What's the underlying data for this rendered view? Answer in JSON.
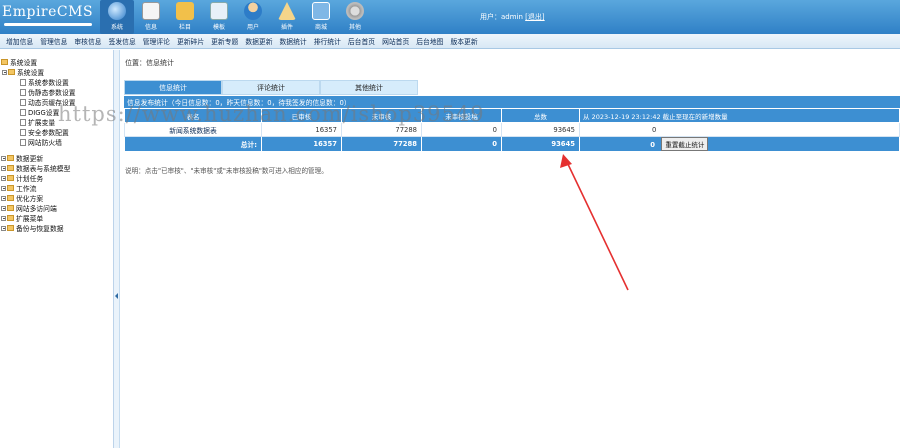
{
  "header": {
    "logo": "EmpireCMS",
    "nav": [
      "系统",
      "信息",
      "栏目",
      "模板",
      "用户",
      "插件",
      "商城",
      "其他"
    ],
    "user_label": "用户：admin",
    "logout": "[退出]"
  },
  "submenu": [
    "增加信息",
    "管理信息",
    "审核信息",
    "签发信息",
    "管理评论",
    "更新碎片",
    "更新专题",
    "数据更新",
    "数据统计",
    "排行统计",
    "后台首页",
    "网站首页",
    "后台地图",
    "版本更新"
  ],
  "sidebar": {
    "items": [
      "系统设置",
      "系统参数设置",
      "伪静态参数设置",
      "动态页缓存设置",
      "DIGG设置",
      "扩展变量",
      "安全参数配置",
      "网站防火墙",
      "数据更新",
      "数据表与系统模型",
      "计划任务",
      "工作流",
      "优化方案",
      "网站多访问端",
      "扩展菜单",
      "备份与恢复数据"
    ]
  },
  "content": {
    "breadcrumb": "位置：信息统计",
    "tabs": [
      "信息统计",
      "评论统计",
      "其他统计"
    ],
    "panel_title": "信息发布统计（今日信息数：0，昨天信息数：0，待我签发的信息数：0）",
    "columns": [
      "表名",
      "已审核",
      "未审核",
      "未审核投稿",
      "总数",
      "从 2023-12-19 23:12:42 截止至现在的新增数量"
    ],
    "rows": [
      {
        "name": "新闻系统数据表",
        "checked": "16357",
        "unchecked": "77288",
        "unchecked_submit": "0",
        "total": "93645",
        "new_count": "0"
      }
    ],
    "total_row": {
      "label": "总计:",
      "checked": "16357",
      "unchecked": "77288",
      "unchecked_submit": "0",
      "total": "93645",
      "new_count": "0",
      "reset_button": "重置截止统计"
    },
    "note": "说明：点击\"已审核\"、\"未审核\"或\"未审核投稿\"数可进入相应的管理。"
  },
  "watermark": "https://www.huzhan.com/ishop39549",
  "colors": {
    "header": "#2f80c6",
    "panel": "#3d8fd2",
    "arrow": "#e53030"
  }
}
